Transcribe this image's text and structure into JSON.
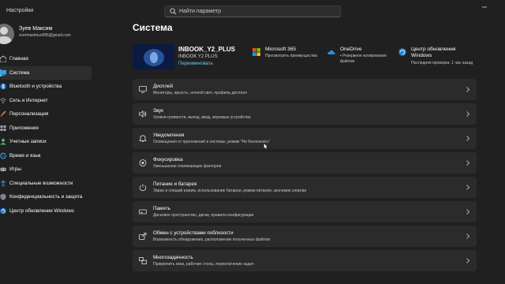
{
  "app": {
    "title": "Настройки"
  },
  "search": {
    "placeholder": "Найти параметр"
  },
  "user": {
    "name": "Зуев Максим",
    "email": "zvermaximus995@gmail.com"
  },
  "nav": {
    "items": [
      {
        "label": "Главная",
        "icon": "home-icon",
        "active": false
      },
      {
        "label": "Система",
        "icon": "system-icon",
        "active": true
      },
      {
        "label": "Bluetooth и устройства",
        "icon": "bluetooth-icon",
        "active": false
      },
      {
        "label": "Сеть и Интернет",
        "icon": "network-icon",
        "active": false
      },
      {
        "label": "Персонализация",
        "icon": "brush-icon",
        "active": false
      },
      {
        "label": "Приложения",
        "icon": "apps-icon",
        "active": false
      },
      {
        "label": "Учетные записи",
        "icon": "account-icon",
        "active": false
      },
      {
        "label": "Время и язык",
        "icon": "globe-icon",
        "active": false
      },
      {
        "label": "Игры",
        "icon": "gamepad-icon",
        "active": false
      },
      {
        "label": "Специальные возможности",
        "icon": "accessibility-icon",
        "active": false
      },
      {
        "label": "Конфиденциальность и защита",
        "icon": "shield-icon",
        "active": false
      },
      {
        "label": "Центр обновления Windows",
        "icon": "update-icon",
        "active": false
      }
    ]
  },
  "page": {
    "title": "Система"
  },
  "device": {
    "name": "INBOOK_Y2_PLUS",
    "model": "INBOOK Y2 PLUS",
    "rename": "Переименовать"
  },
  "tiles": [
    {
      "title": "Microsoft 365",
      "subtitle": "Просмотреть преимущества",
      "icon": "microsoft-icon"
    },
    {
      "title": "OneDrive",
      "subtitle": "• Резервное копирование файлов",
      "icon": "onedrive-icon"
    },
    {
      "title": "Центр обновления Windows",
      "subtitle": "Последняя проверка: 1 час назад",
      "icon": "windows-update-icon"
    }
  ],
  "cards": [
    {
      "title": "Дисплей",
      "subtitle": "Мониторы, яркость, ночной свет, профиль дисплея",
      "icon": "display-icon"
    },
    {
      "title": "Звук",
      "subtitle": "Уровни громкости, выход, ввод, звуковые устройства",
      "icon": "sound-icon"
    },
    {
      "title": "Уведомления",
      "subtitle": "Оповещения от приложений и системы, режим \"Не беспокоить\"",
      "icon": "bell-icon"
    },
    {
      "title": "Фокусировка",
      "subtitle": "Уменьшение отвлекающих факторов",
      "icon": "focus-icon"
    },
    {
      "title": "Питание и батарея",
      "subtitle": "Экран и спящий режим, использование батареи, режим питания, экономия энергии",
      "icon": "power-icon"
    },
    {
      "title": "Память",
      "subtitle": "Дисковое пространство, диски, правила конфигурации",
      "icon": "storage-icon"
    },
    {
      "title": "Обмен с устройствами поблизости",
      "subtitle": "Возможность обнаружения, расположение полученных файлов",
      "icon": "share-icon"
    },
    {
      "title": "Многозадачность",
      "subtitle": "Прикрепить окна, рабочие столы, переключение задач",
      "icon": "multitask-icon"
    }
  ],
  "colors": {
    "accent": "#60cdff",
    "background": "#202020",
    "card": "#2b2b2b"
  }
}
